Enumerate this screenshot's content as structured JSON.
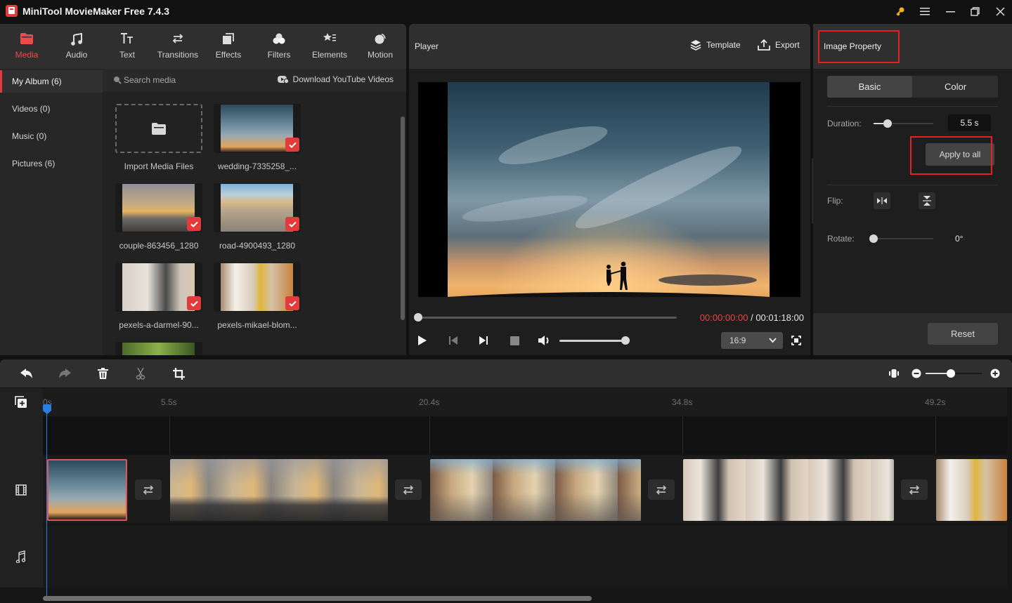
{
  "app": {
    "title": "MiniTool MovieMaker Free 7.4.3"
  },
  "window_controls": {
    "key": "key-icon",
    "menu": "menu-icon",
    "minimize": "minimize-icon",
    "restore": "restore-icon",
    "close": "close-icon"
  },
  "toolbar": {
    "tabs": [
      {
        "label": "Media",
        "icon": "folder-icon",
        "active": true
      },
      {
        "label": "Audio",
        "icon": "music-note-icon"
      },
      {
        "label": "Text",
        "icon": "text-icon"
      },
      {
        "label": "Transitions",
        "icon": "transitions-icon"
      },
      {
        "label": "Effects",
        "icon": "effects-icon"
      },
      {
        "label": "Filters",
        "icon": "filters-icon"
      },
      {
        "label": "Elements",
        "icon": "elements-icon"
      },
      {
        "label": "Motion",
        "icon": "motion-icon"
      }
    ]
  },
  "categories": [
    {
      "label": "My Album (6)",
      "active": true
    },
    {
      "label": "Videos (0)"
    },
    {
      "label": "Music (0)"
    },
    {
      "label": "Pictures (6)"
    }
  ],
  "media": {
    "search_placeholder": "Search media",
    "youtube_link": "Download YouTube Videos",
    "import_label": "Import Media Files",
    "items": [
      {
        "name": "wedding-7335258_...",
        "checked": true
      },
      {
        "name": "couple-863456_1280",
        "checked": true
      },
      {
        "name": "road-4900493_1280",
        "checked": true
      },
      {
        "name": "pexels-a-darmel-90...",
        "checked": true
      },
      {
        "name": "pexels-mikael-blom...",
        "checked": true
      }
    ]
  },
  "player": {
    "title": "Player",
    "template_label": "Template",
    "export_label": "Export",
    "current_time": "00:00:00:00",
    "separator": " / ",
    "total_time": "00:01:18:00",
    "progress": 0,
    "volume": 1.0,
    "aspect_ratio": "16:9"
  },
  "property": {
    "title": "Image Property",
    "tabs": [
      {
        "label": "Basic",
        "active": true
      },
      {
        "label": "Color"
      }
    ],
    "duration_label": "Duration:",
    "duration_value": "5.5 s",
    "duration_slider": 0.23,
    "apply_label": "Apply to all",
    "flip_label": "Flip:",
    "rotate_label": "Rotate:",
    "rotate_value": "0°",
    "rotate_slider": 0,
    "reset_label": "Reset"
  },
  "timeline": {
    "zoom_level": 0.45,
    "ruler": [
      "0s",
      "5.5s",
      "20.4s",
      "34.8s",
      "49.2s"
    ],
    "clips": [
      {
        "name": "wedding-7335258",
        "selected": true
      },
      {
        "name": "couple-863456_1280"
      },
      {
        "name": "road-4900493_1280"
      },
      {
        "name": "pexels-a-darmel"
      },
      {
        "name": "pexels-mikael-blom"
      }
    ]
  },
  "colors": {
    "accent": "#e23b3b",
    "playhead": "#2a7de1",
    "highlight_box": "#e62020"
  }
}
